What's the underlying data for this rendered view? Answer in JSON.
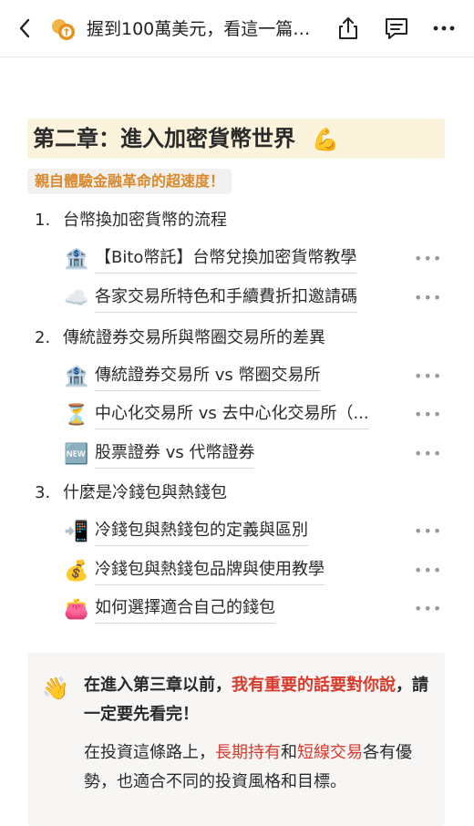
{
  "topbar": {
    "title": "握到100萬美元，看這一篇…",
    "back_icon": "chevron-left-icon",
    "logo_icon": "coin-logo-icon",
    "share_icon": "share-icon",
    "comment_icon": "comment-icon",
    "more_icon": "more-icon"
  },
  "chapter": {
    "title": "第二章：進入加密貨幣世界",
    "emoji": "💪"
  },
  "tagline": "親自體驗金融革命的超速度！",
  "sections": [
    {
      "num": "1.",
      "title": "台幣換加密貨幣的流程",
      "items": [
        {
          "icon": "🏦",
          "label": "【Bito幣託】台幣兌換加密貨幣教學"
        },
        {
          "icon": "☁️",
          "label": "各家交易所特色和手續費折扣邀請碼"
        }
      ]
    },
    {
      "num": "2.",
      "title": "傳統證券交易所與幣圈交易所的差異",
      "items": [
        {
          "icon": "🏦",
          "label": "傳統證券交易所 vs 幣圈交易所"
        },
        {
          "icon": "⏳",
          "label": "中心化交易所 vs 去中心化交易所（..."
        },
        {
          "icon": "🆕",
          "label": "股票證券 vs 代幣證券"
        }
      ]
    },
    {
      "num": "3.",
      "title": "什麼是冷錢包與熱錢包",
      "items": [
        {
          "icon": "📲",
          "label": "冷錢包與熱錢包的定義與區別"
        },
        {
          "icon": "💰",
          "label": "冷錢包與熱錢包品牌與使用教學"
        },
        {
          "icon": "👛",
          "label": "如何選擇適合自己的錢包"
        }
      ]
    }
  ],
  "item_more": "•••",
  "callout": {
    "emoji": "👋",
    "p1_a": "在進入第三章以前，",
    "p1_red": "我有重要的話要對你說",
    "p1_b": "，請一定要先看完！",
    "p2_a": "在投資這條路上，",
    "p2_red1": "長期持有",
    "p2_mid": "和",
    "p2_red2": "短線交易",
    "p2_b": "各有優勢，也適合不同的投資風格和目標。"
  },
  "colors": {
    "accent_orange": "#d9892c",
    "highlight_red": "#d93a2b",
    "chapter_bg": "#fbf3dc",
    "callout_bg": "#f7f6f4"
  }
}
